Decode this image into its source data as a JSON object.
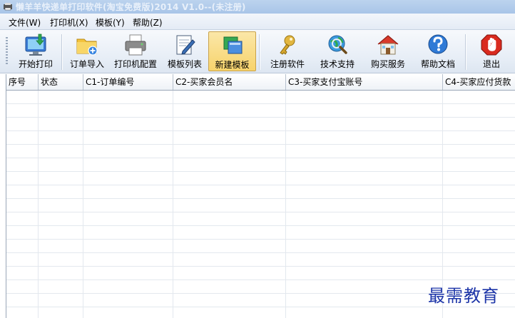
{
  "window": {
    "title": "懒羊羊快递单打印软件(淘宝免费版)2014 V1.0--(未注册)"
  },
  "menu": [
    {
      "label": "文件(W)"
    },
    {
      "label": "打印机(X)"
    },
    {
      "label": "模板(Y)"
    },
    {
      "label": "帮助(Z)"
    }
  ],
  "toolbar": {
    "buttons": [
      {
        "label": "开始打印",
        "icon": "monitor-print-icon"
      },
      {
        "label": "订单导入",
        "icon": "folder-add-icon"
      },
      {
        "label": "打印机配置",
        "icon": "printer-icon"
      },
      {
        "label": "模板列表",
        "icon": "template-edit-icon"
      },
      {
        "label": "新建模板",
        "icon": "new-template-icon",
        "active": true
      },
      {
        "label": "注册软件",
        "icon": "key-icon"
      },
      {
        "label": "技术支持",
        "icon": "globe-search-icon"
      },
      {
        "label": "购买服务",
        "icon": "house-icon"
      },
      {
        "label": "帮助文档",
        "icon": "help-icon"
      },
      {
        "label": "退出",
        "icon": "stop-exit-icon"
      }
    ]
  },
  "table": {
    "columns": [
      "序号",
      "状态",
      "C1-订单编号",
      "C2-买家会员名",
      "C3-买家支付宝账号",
      "C4-买家应付货款"
    ],
    "rows": []
  },
  "watermark": "最需教育",
  "colors": {
    "accent": "#f7d36c",
    "watermark": "#1d35a8"
  }
}
